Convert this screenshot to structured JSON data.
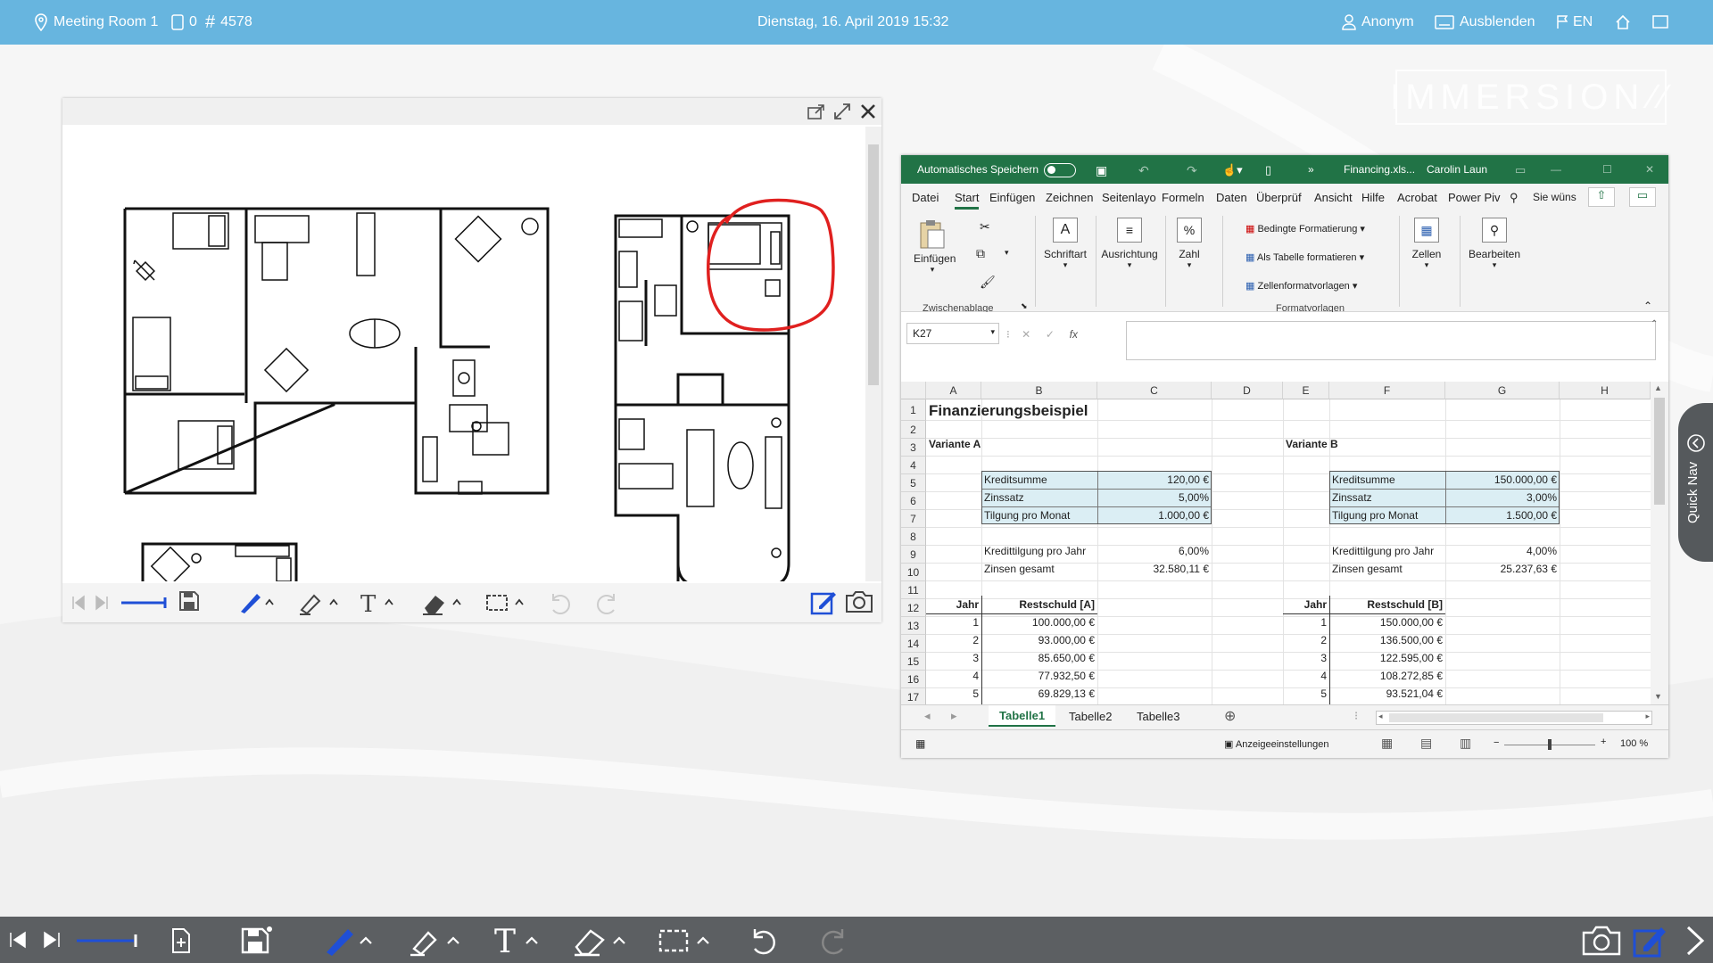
{
  "topbar": {
    "room": "Meeting Room 1",
    "device_count": "0",
    "session_id": "4578",
    "datetime": "Dienstag, 16. April 2019   15:32",
    "user": "Anonym",
    "hide_label": "Ausblenden",
    "language": "EN"
  },
  "brand": {
    "logo_text": "IMMERSION"
  },
  "excel": {
    "autosave_label": "Automatisches Speichern",
    "file_name": "Financing.xls...",
    "user_name": "Carolin Laun",
    "tabs": [
      "Datei",
      "Start",
      "Einfügen",
      "Zeichnen",
      "Seitenlayo",
      "Formeln",
      "Daten",
      "Überprüf",
      "Ansicht",
      "Hilfe",
      "Acrobat",
      "Power Piv"
    ],
    "search_placeholder": "Sie wüns",
    "ribbon": {
      "paste": "Einfügen",
      "clipboard_group": "Zwischenablage",
      "font": "Schriftart",
      "alignment": "Ausrichtung",
      "number": "Zahl",
      "conditional": "Bedingte Formatierung",
      "as_table": "Als Tabelle formatieren",
      "cell_styles": "Zellenformatvorlagen",
      "styles_group": "Formatvorlagen",
      "cells": "Zellen",
      "editing": "Bearbeiten"
    },
    "name_box": "K27",
    "columns": [
      "A",
      "B",
      "C",
      "D",
      "E",
      "F",
      "G",
      "H"
    ],
    "rows": [
      "1",
      "2",
      "3",
      "4",
      "5",
      "6",
      "7",
      "8",
      "9",
      "10",
      "11",
      "12",
      "13",
      "14",
      "15",
      "16",
      "17"
    ],
    "cells": {
      "title": "Finanzierungsbeispiel",
      "variant_a": "Variante A",
      "variant_b": "Variante B",
      "a_labels": [
        "Kreditsumme",
        "Zinssatz",
        "Tilgung pro Monat"
      ],
      "a_values": [
        "120,00 €",
        "5,00%",
        "1.000,00 €"
      ],
      "b_labels": [
        "Kreditsumme",
        "Zinssatz",
        "Tilgung pro Monat"
      ],
      "b_values": [
        "150.000,00 €",
        "3,00%",
        "1.500,00 €"
      ],
      "a_summary_labels": [
        "Kredittilgung pro Jahr",
        "Zinsen gesamt"
      ],
      "a_summary_values": [
        "6,00%",
        "32.580,11 €"
      ],
      "b_summary_labels": [
        "Kredittilgung pro Jahr",
        "Zinsen gesamt"
      ],
      "b_summary_values": [
        "4,00%",
        "25.237,63 €"
      ],
      "year_header": "Jahr",
      "rest_a_header": "Restschuld [A]",
      "rest_b_header": "Restschuld [B]",
      "years": [
        "1",
        "2",
        "3",
        "4",
        "5"
      ],
      "rest_a": [
        "100.000,00 €",
        "93.000,00 €",
        "85.650,00 €",
        "77.932,50 €",
        "69.829,13 €"
      ],
      "rest_b": [
        "150.000,00 €",
        "136.500,00 €",
        "122.595,00 €",
        "108.272,85 €",
        "93.521,04 €"
      ]
    },
    "sheets": [
      "Tabelle1",
      "Tabelle2",
      "Tabelle3"
    ],
    "display_settings": "Anzeigeeinstellungen",
    "zoom": "100 %"
  },
  "quicknav": {
    "label": "Quick Nav"
  },
  "colors": {
    "topbar": "#67b5df",
    "excel_green": "#217346",
    "pen_blue": "#1f4fd6",
    "annotation_red": "#e0201f"
  }
}
